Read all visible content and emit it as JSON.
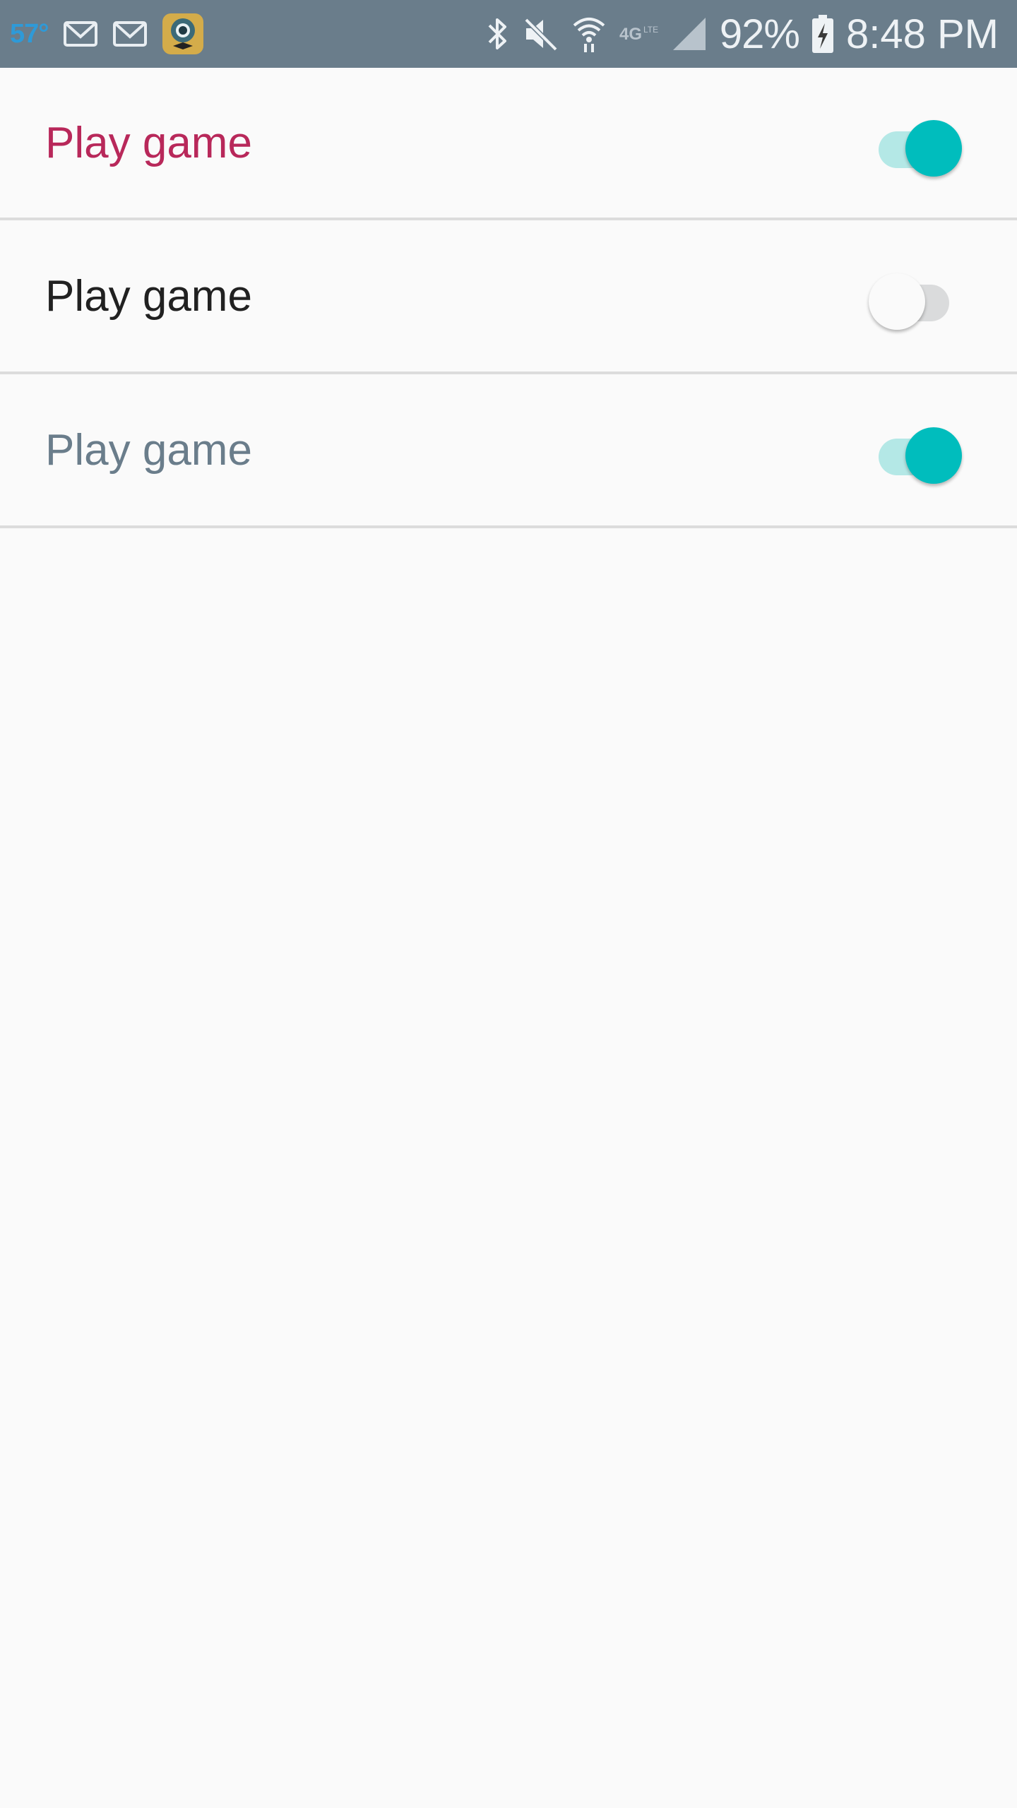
{
  "status_bar": {
    "temperature": "57°",
    "battery_percent": "92%",
    "time": "8:48 PM",
    "icons": [
      "gmail-icon",
      "gmail-icon",
      "app-icon",
      "bluetooth-icon",
      "mute-icon",
      "wifi-icon",
      "lte-icon",
      "signal-icon",
      "battery-charging-icon"
    ],
    "bar_color": "#6a7d8b"
  },
  "settings": {
    "items": [
      {
        "label": "Play game",
        "checked": true,
        "label_color": "#b8285a"
      },
      {
        "label": "Play game",
        "checked": false,
        "label_color": "#212121"
      },
      {
        "label": "Play game",
        "checked": true,
        "label_color": "#6a7d8b"
      }
    ]
  },
  "colors": {
    "accent": "#00bdbd",
    "accent_track": "#b4e8e6",
    "background": "#fafafa",
    "divider": "#dcdcdc"
  }
}
